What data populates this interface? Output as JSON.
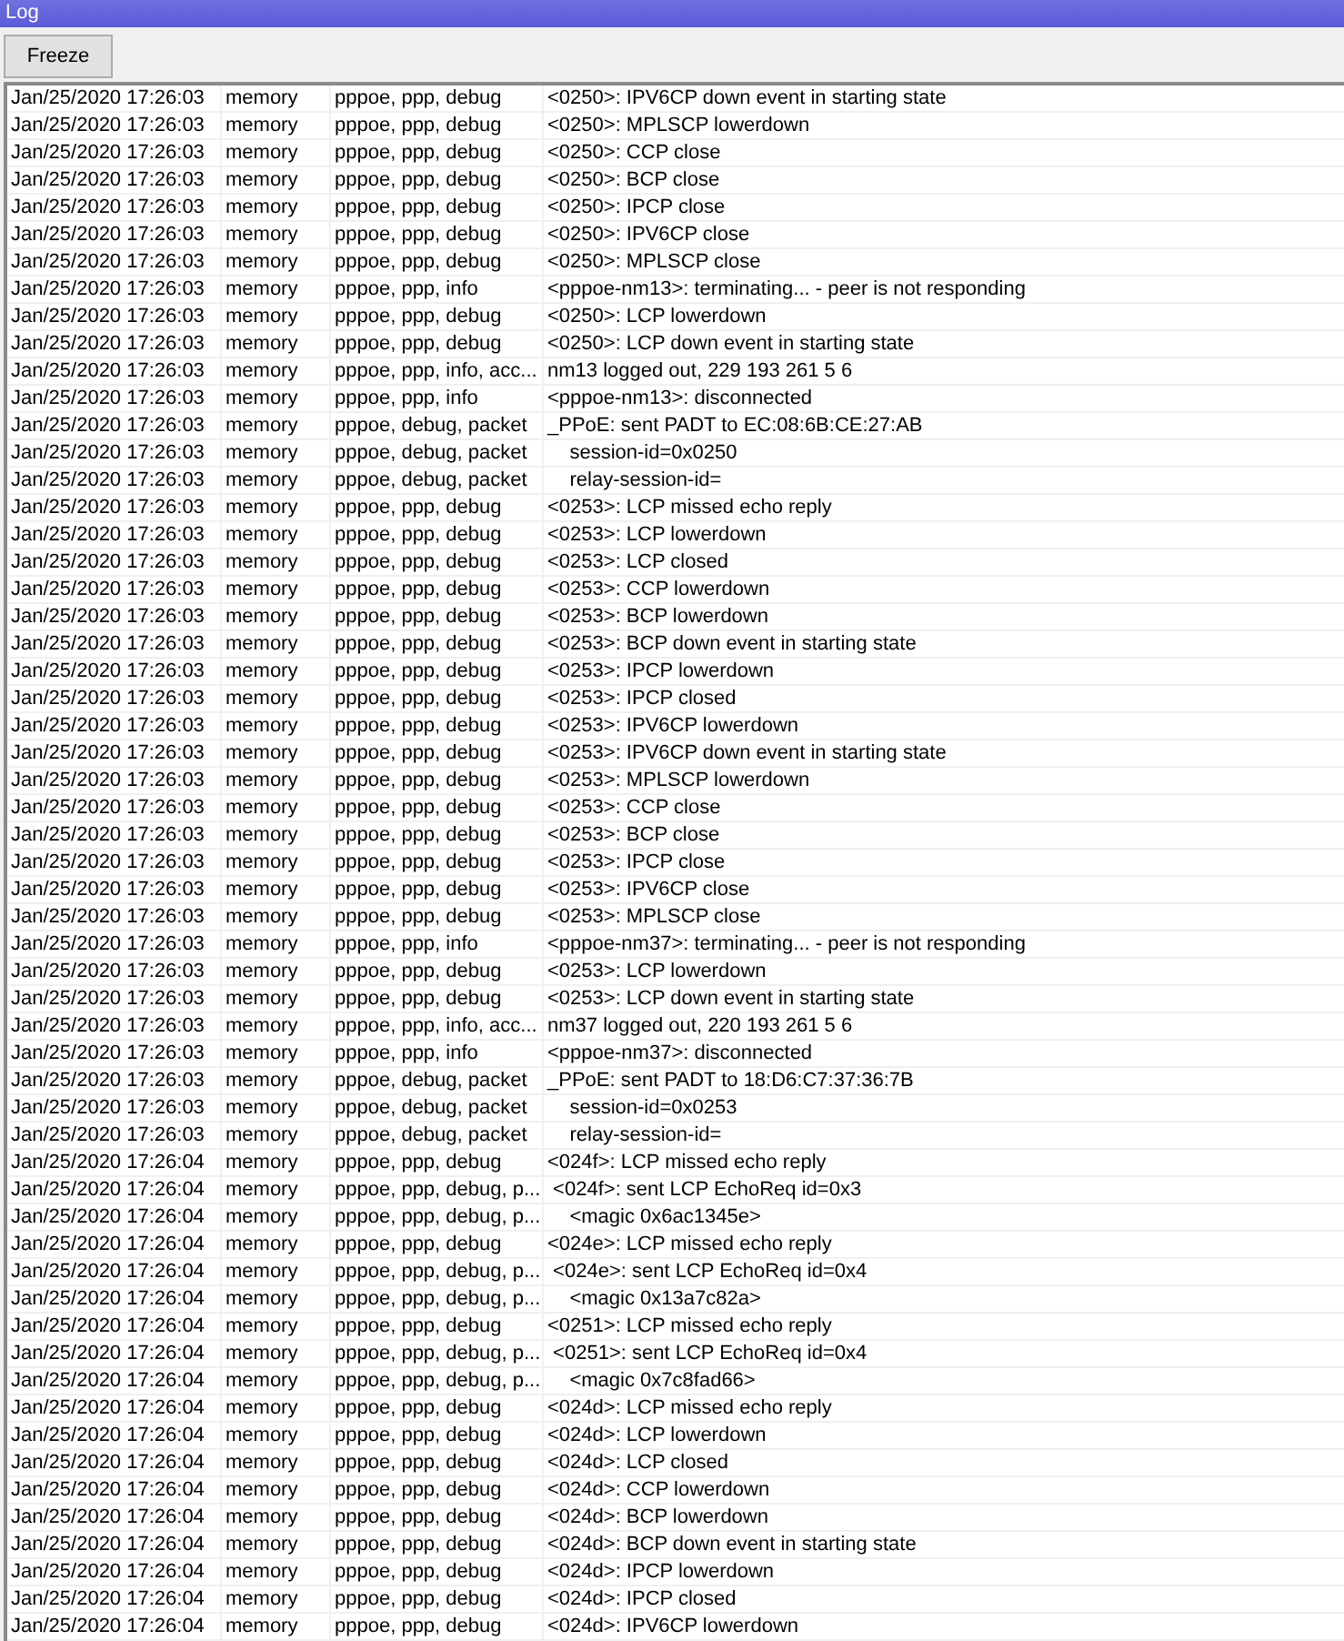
{
  "window": {
    "title": "Log"
  },
  "toolbar": {
    "buttons": [
      "Freeze"
    ]
  },
  "log": {
    "rows": [
      {
        "time": "Jan/25/2020 17:26:03",
        "buffer": "memory",
        "topics": "pppoe, ppp, debug",
        "message": "<0250>: IPV6CP down event in starting state"
      },
      {
        "time": "Jan/25/2020 17:26:03",
        "buffer": "memory",
        "topics": "pppoe, ppp, debug",
        "message": "<0250>: MPLSCP lowerdown"
      },
      {
        "time": "Jan/25/2020 17:26:03",
        "buffer": "memory",
        "topics": "pppoe, ppp, debug",
        "message": "<0250>: CCP close"
      },
      {
        "time": "Jan/25/2020 17:26:03",
        "buffer": "memory",
        "topics": "pppoe, ppp, debug",
        "message": "<0250>: BCP close"
      },
      {
        "time": "Jan/25/2020 17:26:03",
        "buffer": "memory",
        "topics": "pppoe, ppp, debug",
        "message": "<0250>: IPCP close"
      },
      {
        "time": "Jan/25/2020 17:26:03",
        "buffer": "memory",
        "topics": "pppoe, ppp, debug",
        "message": "<0250>: IPV6CP close"
      },
      {
        "time": "Jan/25/2020 17:26:03",
        "buffer": "memory",
        "topics": "pppoe, ppp, debug",
        "message": "<0250>: MPLSCP close"
      },
      {
        "time": "Jan/25/2020 17:26:03",
        "buffer": "memory",
        "topics": "pppoe, ppp, info",
        "message": "<pppoe-nm13>: terminating... - peer is not responding"
      },
      {
        "time": "Jan/25/2020 17:26:03",
        "buffer": "memory",
        "topics": "pppoe, ppp, debug",
        "message": "<0250>: LCP lowerdown"
      },
      {
        "time": "Jan/25/2020 17:26:03",
        "buffer": "memory",
        "topics": "pppoe, ppp, debug",
        "message": "<0250>: LCP down event in starting state"
      },
      {
        "time": "Jan/25/2020 17:26:03",
        "buffer": "memory",
        "topics": "pppoe, ppp, info, acc...",
        "message": "nm13 logged out, 229 193 261 5 6"
      },
      {
        "time": "Jan/25/2020 17:26:03",
        "buffer": "memory",
        "topics": "pppoe, ppp, info",
        "message": "<pppoe-nm13>: disconnected"
      },
      {
        "time": "Jan/25/2020 17:26:03",
        "buffer": "memory",
        "topics": "pppoe, debug, packet",
        "message": "_PPoE: sent PADT to EC:08:6B:CE:27:AB"
      },
      {
        "time": "Jan/25/2020 17:26:03",
        "buffer": "memory",
        "topics": "pppoe, debug, packet",
        "message": "    session-id=0x0250"
      },
      {
        "time": "Jan/25/2020 17:26:03",
        "buffer": "memory",
        "topics": "pppoe, debug, packet",
        "message": "    relay-session-id="
      },
      {
        "time": "Jan/25/2020 17:26:03",
        "buffer": "memory",
        "topics": "pppoe, ppp, debug",
        "message": "<0253>: LCP missed echo reply"
      },
      {
        "time": "Jan/25/2020 17:26:03",
        "buffer": "memory",
        "topics": "pppoe, ppp, debug",
        "message": "<0253>: LCP lowerdown"
      },
      {
        "time": "Jan/25/2020 17:26:03",
        "buffer": "memory",
        "topics": "pppoe, ppp, debug",
        "message": "<0253>: LCP closed"
      },
      {
        "time": "Jan/25/2020 17:26:03",
        "buffer": "memory",
        "topics": "pppoe, ppp, debug",
        "message": "<0253>: CCP lowerdown"
      },
      {
        "time": "Jan/25/2020 17:26:03",
        "buffer": "memory",
        "topics": "pppoe, ppp, debug",
        "message": "<0253>: BCP lowerdown"
      },
      {
        "time": "Jan/25/2020 17:26:03",
        "buffer": "memory",
        "topics": "pppoe, ppp, debug",
        "message": "<0253>: BCP down event in starting state"
      },
      {
        "time": "Jan/25/2020 17:26:03",
        "buffer": "memory",
        "topics": "pppoe, ppp, debug",
        "message": "<0253>: IPCP lowerdown"
      },
      {
        "time": "Jan/25/2020 17:26:03",
        "buffer": "memory",
        "topics": "pppoe, ppp, debug",
        "message": "<0253>: IPCP closed"
      },
      {
        "time": "Jan/25/2020 17:26:03",
        "buffer": "memory",
        "topics": "pppoe, ppp, debug",
        "message": "<0253>: IPV6CP lowerdown"
      },
      {
        "time": "Jan/25/2020 17:26:03",
        "buffer": "memory",
        "topics": "pppoe, ppp, debug",
        "message": "<0253>: IPV6CP down event in starting state"
      },
      {
        "time": "Jan/25/2020 17:26:03",
        "buffer": "memory",
        "topics": "pppoe, ppp, debug",
        "message": "<0253>: MPLSCP lowerdown"
      },
      {
        "time": "Jan/25/2020 17:26:03",
        "buffer": "memory",
        "topics": "pppoe, ppp, debug",
        "message": "<0253>: CCP close"
      },
      {
        "time": "Jan/25/2020 17:26:03",
        "buffer": "memory",
        "topics": "pppoe, ppp, debug",
        "message": "<0253>: BCP close"
      },
      {
        "time": "Jan/25/2020 17:26:03",
        "buffer": "memory",
        "topics": "pppoe, ppp, debug",
        "message": "<0253>: IPCP close"
      },
      {
        "time": "Jan/25/2020 17:26:03",
        "buffer": "memory",
        "topics": "pppoe, ppp, debug",
        "message": "<0253>: IPV6CP close"
      },
      {
        "time": "Jan/25/2020 17:26:03",
        "buffer": "memory",
        "topics": "pppoe, ppp, debug",
        "message": "<0253>: MPLSCP close"
      },
      {
        "time": "Jan/25/2020 17:26:03",
        "buffer": "memory",
        "topics": "pppoe, ppp, info",
        "message": "<pppoe-nm37>: terminating... - peer is not responding"
      },
      {
        "time": "Jan/25/2020 17:26:03",
        "buffer": "memory",
        "topics": "pppoe, ppp, debug",
        "message": "<0253>: LCP lowerdown"
      },
      {
        "time": "Jan/25/2020 17:26:03",
        "buffer": "memory",
        "topics": "pppoe, ppp, debug",
        "message": "<0253>: LCP down event in starting state"
      },
      {
        "time": "Jan/25/2020 17:26:03",
        "buffer": "memory",
        "topics": "pppoe, ppp, info, acc...",
        "message": "nm37 logged out, 220 193 261 5 6"
      },
      {
        "time": "Jan/25/2020 17:26:03",
        "buffer": "memory",
        "topics": "pppoe, ppp, info",
        "message": "<pppoe-nm37>: disconnected"
      },
      {
        "time": "Jan/25/2020 17:26:03",
        "buffer": "memory",
        "topics": "pppoe, debug, packet",
        "message": "_PPoE: sent PADT to 18:D6:C7:37:36:7B"
      },
      {
        "time": "Jan/25/2020 17:26:03",
        "buffer": "memory",
        "topics": "pppoe, debug, packet",
        "message": "    session-id=0x0253"
      },
      {
        "time": "Jan/25/2020 17:26:03",
        "buffer": "memory",
        "topics": "pppoe, debug, packet",
        "message": "    relay-session-id="
      },
      {
        "time": "Jan/25/2020 17:26:04",
        "buffer": "memory",
        "topics": "pppoe, ppp, debug",
        "message": "<024f>: LCP missed echo reply"
      },
      {
        "time": "Jan/25/2020 17:26:04",
        "buffer": "memory",
        "topics": "pppoe, ppp, debug, p...",
        "message": " <024f>: sent LCP EchoReq id=0x3"
      },
      {
        "time": "Jan/25/2020 17:26:04",
        "buffer": "memory",
        "topics": "pppoe, ppp, debug, p...",
        "message": "    <magic 0x6ac1345e>"
      },
      {
        "time": "Jan/25/2020 17:26:04",
        "buffer": "memory",
        "topics": "pppoe, ppp, debug",
        "message": "<024e>: LCP missed echo reply"
      },
      {
        "time": "Jan/25/2020 17:26:04",
        "buffer": "memory",
        "topics": "pppoe, ppp, debug, p...",
        "message": " <024e>: sent LCP EchoReq id=0x4"
      },
      {
        "time": "Jan/25/2020 17:26:04",
        "buffer": "memory",
        "topics": "pppoe, ppp, debug, p...",
        "message": "    <magic 0x13a7c82a>"
      },
      {
        "time": "Jan/25/2020 17:26:04",
        "buffer": "memory",
        "topics": "pppoe, ppp, debug",
        "message": "<0251>: LCP missed echo reply"
      },
      {
        "time": "Jan/25/2020 17:26:04",
        "buffer": "memory",
        "topics": "pppoe, ppp, debug, p...",
        "message": " <0251>: sent LCP EchoReq id=0x4"
      },
      {
        "time": "Jan/25/2020 17:26:04",
        "buffer": "memory",
        "topics": "pppoe, ppp, debug, p...",
        "message": "    <magic 0x7c8fad66>"
      },
      {
        "time": "Jan/25/2020 17:26:04",
        "buffer": "memory",
        "topics": "pppoe, ppp, debug",
        "message": "<024d>: LCP missed echo reply"
      },
      {
        "time": "Jan/25/2020 17:26:04",
        "buffer": "memory",
        "topics": "pppoe, ppp, debug",
        "message": "<024d>: LCP lowerdown"
      },
      {
        "time": "Jan/25/2020 17:26:04",
        "buffer": "memory",
        "topics": "pppoe, ppp, debug",
        "message": "<024d>: LCP closed"
      },
      {
        "time": "Jan/25/2020 17:26:04",
        "buffer": "memory",
        "topics": "pppoe, ppp, debug",
        "message": "<024d>: CCP lowerdown"
      },
      {
        "time": "Jan/25/2020 17:26:04",
        "buffer": "memory",
        "topics": "pppoe, ppp, debug",
        "message": "<024d>: BCP lowerdown"
      },
      {
        "time": "Jan/25/2020 17:26:04",
        "buffer": "memory",
        "topics": "pppoe, ppp, debug",
        "message": "<024d>: BCP down event in starting state"
      },
      {
        "time": "Jan/25/2020 17:26:04",
        "buffer": "memory",
        "topics": "pppoe, ppp, debug",
        "message": "<024d>: IPCP lowerdown"
      },
      {
        "time": "Jan/25/2020 17:26:04",
        "buffer": "memory",
        "topics": "pppoe, ppp, debug",
        "message": "<024d>: IPCP closed"
      },
      {
        "time": "Jan/25/2020 17:26:04",
        "buffer": "memory",
        "topics": "pppoe, ppp, debug",
        "message": "<024d>: IPV6CP lowerdown"
      }
    ]
  }
}
